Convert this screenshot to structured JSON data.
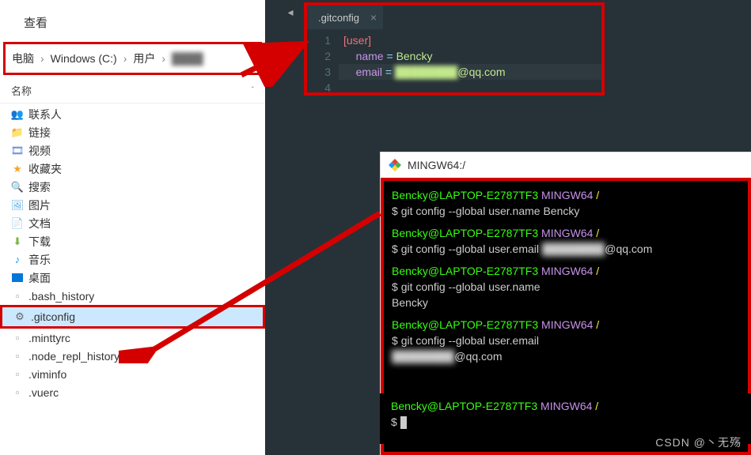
{
  "explorer": {
    "view_label": "查看",
    "breadcrumb": {
      "root": "电脑",
      "drive": "Windows (C:)",
      "folder": "用户",
      "user_blurred": "████"
    },
    "name_header": "名称",
    "items": [
      {
        "label": "联系人",
        "icon": "contacts"
      },
      {
        "label": "链接",
        "icon": "links"
      },
      {
        "label": "视频",
        "icon": "video"
      },
      {
        "label": "收藏夹",
        "icon": "fav"
      },
      {
        "label": "搜索",
        "icon": "search"
      },
      {
        "label": "图片",
        "icon": "pic"
      },
      {
        "label": "文档",
        "icon": "doc"
      },
      {
        "label": "下载",
        "icon": "download"
      },
      {
        "label": "音乐",
        "icon": "music"
      },
      {
        "label": "桌面",
        "icon": "desktop"
      },
      {
        "label": ".bash_history",
        "icon": "file"
      },
      {
        "label": ".gitconfig",
        "icon": "gear",
        "selected": true
      },
      {
        "label": ".minttyrc",
        "icon": "file"
      },
      {
        "label": ".node_repl_history",
        "icon": "file"
      },
      {
        "label": ".viminfo",
        "icon": "file"
      },
      {
        "label": ".vuerc",
        "icon": "file"
      }
    ]
  },
  "editor": {
    "tab_name": ".gitconfig",
    "lines": [
      "1",
      "2",
      "3",
      "4"
    ],
    "code": {
      "section": "[user]",
      "name_key": "name",
      "name_val": "Bencky",
      "email_key": "email",
      "email_domain": "@qq.com",
      "eq": " = "
    }
  },
  "terminal": {
    "title": "MINGW64:/",
    "prompt_user": "Bencky@LAPTOP-E2787TF3",
    "prompt_env": "MINGW64",
    "prompt_path": "/",
    "dollar": "$ ",
    "cmds": {
      "set_name": "git config --global user.name Bencky",
      "set_email_prefix": "git config --global user.email ",
      "set_email_domain": "@qq.com",
      "get_name": "git config --global user.name",
      "get_name_out": "Bencky",
      "get_email": "git config --global user.email",
      "get_email_domain": "@qq.com"
    }
  },
  "watermark": "CSDN @丶无殇"
}
